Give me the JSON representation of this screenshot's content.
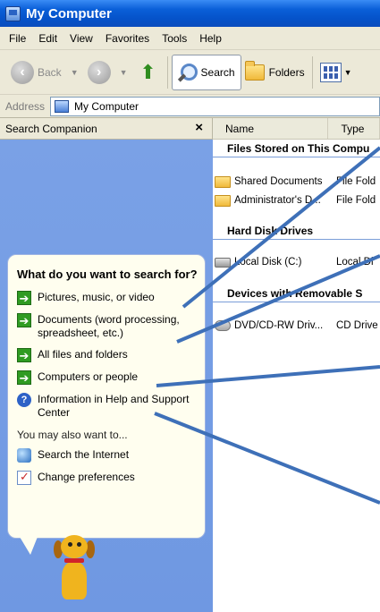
{
  "window": {
    "title": "My Computer"
  },
  "menu": [
    "File",
    "Edit",
    "View",
    "Favorites",
    "Tools",
    "Help"
  ],
  "toolbar": {
    "back": "Back",
    "search": "Search",
    "folders": "Folders"
  },
  "address": {
    "label": "Address",
    "value": "My Computer"
  },
  "search_companion": {
    "header": "Search Companion",
    "close_glyph": "×",
    "question": "What do you want to search for?",
    "options": [
      "Pictures, music, or video",
      "Documents (word processing, spreadsheet, etc.)",
      "All files and folders",
      "Computers or people",
      "Information in Help and Support Center"
    ],
    "also_label": "You may also want to...",
    "also_options": [
      "Search the Internet",
      "Change preferences"
    ]
  },
  "columns": {
    "name": "Name",
    "type": "Type"
  },
  "groups": [
    {
      "title": "Files Stored on This Compu",
      "items": [
        {
          "name": "Shared Documents",
          "type": "File Fold"
        },
        {
          "name": "Administrator's D...",
          "type": "File Fold"
        }
      ]
    },
    {
      "title": "Hard Disk Drives",
      "items": [
        {
          "name": "Local Disk (C:)",
          "type": "Local Di"
        }
      ]
    },
    {
      "title": "Devices with Removable S",
      "items": [
        {
          "name": "DVD/CD-RW Driv...",
          "type": "CD Drive"
        }
      ]
    }
  ],
  "colors": {
    "title_bar": "#0a5fd8",
    "sidebar": "#7aa1e6",
    "callout_line": "#3e70b8"
  }
}
